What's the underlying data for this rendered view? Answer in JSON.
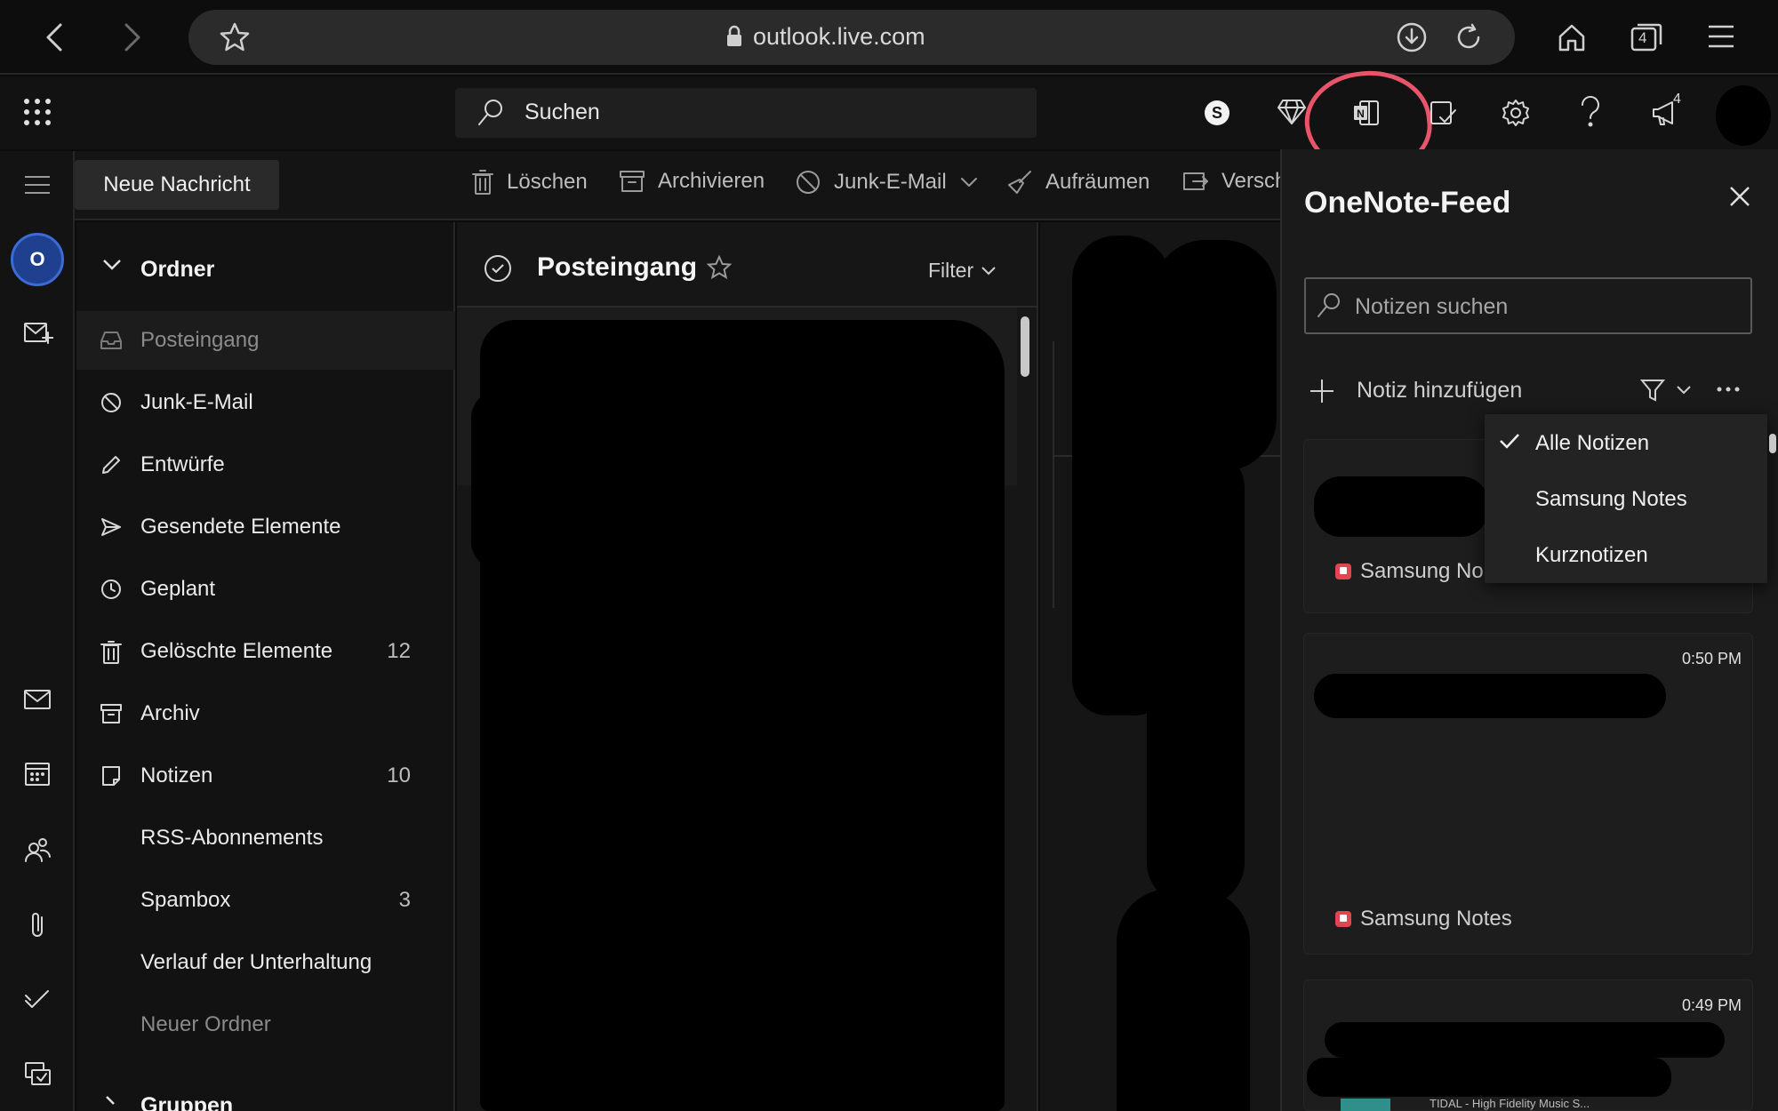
{
  "browser": {
    "url": "outlook.live.com",
    "tab_count": "4",
    "icons": [
      "back-icon",
      "forward-icon",
      "star-icon",
      "lock-icon",
      "download-icon",
      "reload-icon",
      "home-icon",
      "tabs-icon",
      "menu-icon"
    ]
  },
  "header": {
    "search_placeholder": "Suchen",
    "notification_count": "4",
    "icons": [
      "app-launcher-icon",
      "skype-icon",
      "premium-diamond-icon",
      "onenote-icon",
      "todo-icon",
      "settings-icon",
      "help-icon",
      "whats-new-icon"
    ]
  },
  "toolbar": {
    "new_message": "Neue Nachricht",
    "delete": "Löschen",
    "archive": "Archivieren",
    "junk": "Junk-E-Mail",
    "sweep": "Aufräumen",
    "move": "Versch"
  },
  "folders": {
    "header": "Ordner",
    "items": [
      {
        "label": "Posteingang",
        "count": ""
      },
      {
        "label": "Junk-E-Mail",
        "count": ""
      },
      {
        "label": "Entwürfe",
        "count": ""
      },
      {
        "label": "Gesendete Elemente",
        "count": ""
      },
      {
        "label": "Geplant",
        "count": ""
      },
      {
        "label": "Gelöschte Elemente",
        "count": "12"
      },
      {
        "label": "Archiv",
        "count": ""
      },
      {
        "label": "Notizen",
        "count": "10"
      },
      {
        "label": "RSS-Abonnements",
        "count": ""
      },
      {
        "label": "Spambox",
        "count": "3"
      },
      {
        "label": "Verlauf der Unterhaltung",
        "count": ""
      },
      {
        "label": "Neuer Ordner",
        "count": ""
      }
    ],
    "groups_header": "Gruppen"
  },
  "mail_list": {
    "title": "Posteingang",
    "filter": "Filter"
  },
  "onenote": {
    "title": "OneNote-Feed",
    "search_placeholder": "Notizen suchen",
    "add_note": "Notiz hinzufügen",
    "filter_menu": [
      "Alle Notizen",
      "Samsung Notes",
      "Kurznotizen"
    ],
    "notes": [
      {
        "time": "",
        "source": "Samsung No"
      },
      {
        "time": "0:50 PM",
        "source": "Samsung Notes"
      },
      {
        "time": "0:49 PM",
        "source": "",
        "preview": "TIDAL - High Fidelity Music S..."
      }
    ]
  },
  "colors": {
    "accent_highlight": "#e8546a",
    "samsung_notes_badge": "#e0464f",
    "background": "#0b0b0b"
  }
}
